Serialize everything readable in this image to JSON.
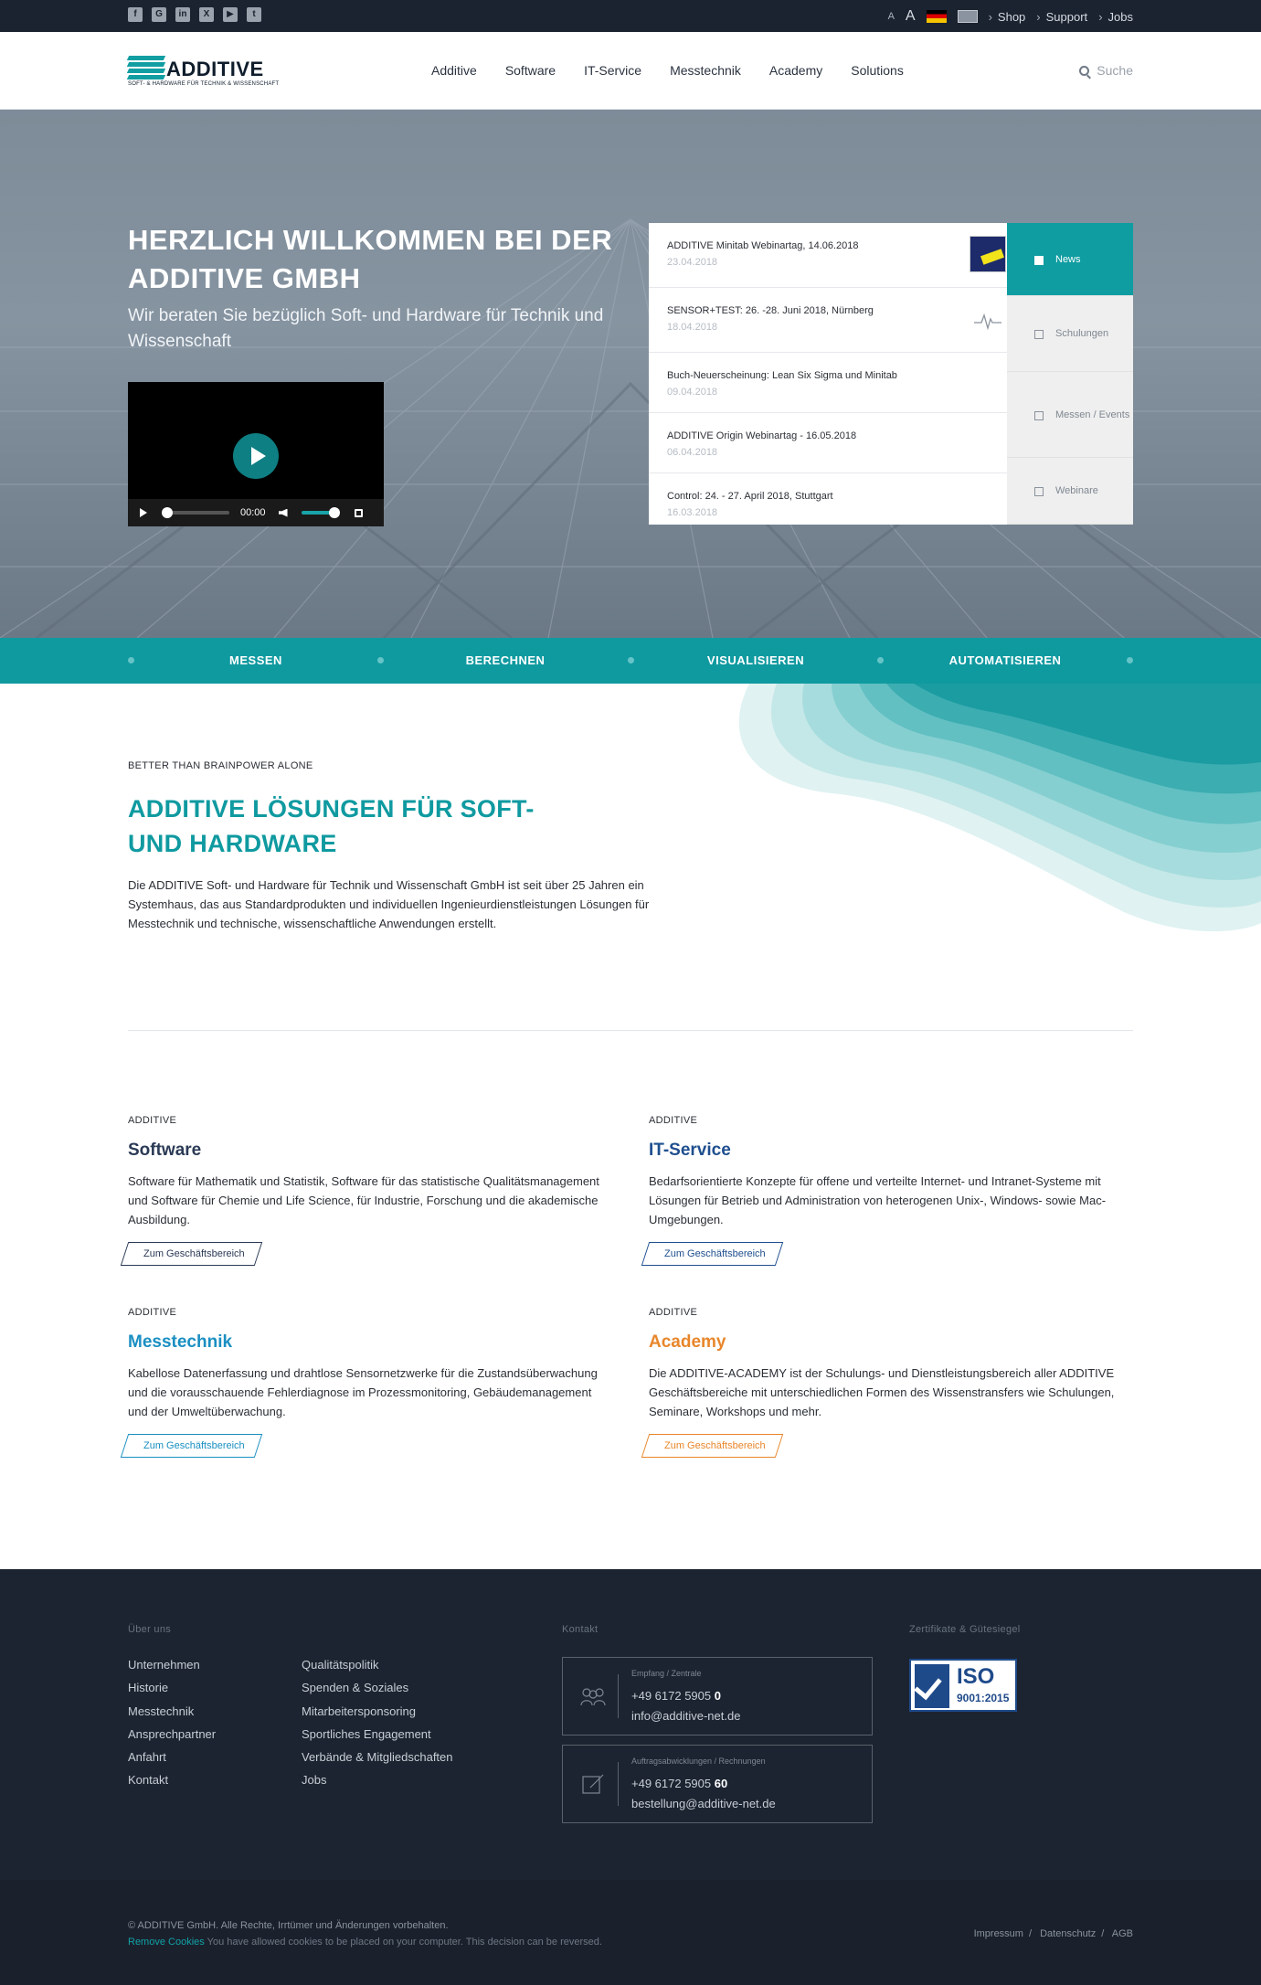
{
  "topbar": {
    "social_icons": [
      "facebook-icon",
      "google-plus-icon",
      "linkedin-icon",
      "xing-icon",
      "youtube-icon",
      "twitter-icon"
    ],
    "font_small": "A",
    "font_large": "A",
    "links": [
      "Shop",
      "Support",
      "Jobs"
    ]
  },
  "header": {
    "logo_text": "ADDITIVE",
    "logo_sub": "SOFT- & HARDWARE FÜR TECHNIK & WISSENSCHAFT",
    "nav": [
      "Additive",
      "Software",
      "IT-Service",
      "Messtechnik",
      "Academy",
      "Solutions"
    ],
    "search_placeholder": "Suche"
  },
  "hero": {
    "title": "HERZLICH WILLKOMMEN BEI DER ADDITIVE GMBH",
    "subtitle": "Wir beraten Sie bezüglich Soft- und Hardware für Technik und Wissenschaft",
    "video_time": "00:00",
    "news": [
      {
        "title": "ADDITIVE Minitab Webinartag, 14.06.2018",
        "date": "23.04.2018"
      },
      {
        "title": "SENSOR+TEST: 26. -28. Juni 2018, Nürnberg",
        "date": "18.04.2018"
      },
      {
        "title": "Buch-Neuerscheinung: Lean Six Sigma und Minitab",
        "date": "09.04.2018"
      },
      {
        "title": "ADDITIVE Origin Webinartag - 16.05.2018",
        "date": "06.04.2018"
      },
      {
        "title": "Control: 24. - 27. April 2018, Stuttgart",
        "date": "16.03.2018"
      }
    ],
    "tabs": [
      "News",
      "Schulungen",
      "Messen / Events",
      "Webinare"
    ]
  },
  "band": [
    "MESSEN",
    "BERECHNEN",
    "VISUALISIEREN",
    "AUTOMATISIEREN"
  ],
  "intro": {
    "eyebrow": "BETTER THAN BRAINPOWER ALONE",
    "title": "ADDITIVE LÖSUNGEN FÜR SOFT- UND HARDWARE",
    "text": "Die ADDITIVE Soft- und Hardware für Technik und Wissenschaft GmbH ist seit über 25 Jahren ein Systemhaus, das aus Standardprodukten und individuellen Ingenieurdienstleistungen Lösungen für Messtechnik und technische, wissenschaftliche Anwendungen erstellt."
  },
  "business": [
    {
      "eyebrow": "ADDITIVE",
      "title": "Software",
      "color": "#2b3a55",
      "text": "Software für Mathematik und Statistik, Software für das statistische Qualitätsmanagement und Software für Chemie und Life Science, für Industrie, Forschung und die akademische Ausbildung.",
      "button": "Zum Geschäftsbereich"
    },
    {
      "eyebrow": "ADDITIVE",
      "title": "IT-Service",
      "color": "#1f4f8f",
      "text": "Bedarfsorientierte Konzepte für offene und verteilte Internet- und Intranet-Systeme mit Lösungen für Betrieb und Administration von heterogenen Unix-, Windows- sowie Mac- Umgebungen.",
      "button": "Zum Geschäftsbereich"
    },
    {
      "eyebrow": "ADDITIVE",
      "title": "Messtechnik",
      "color": "#1a8fc2",
      "text": "Kabellose Datenerfassung und drahtlose Sensornetzwerke für die Zustandsüberwachung und die vorausschauende Fehlerdiagnose im Prozessmonitoring, Gebäudemanagement und der Umweltüberwachung.",
      "button": "Zum Geschäftsbereich"
    },
    {
      "eyebrow": "ADDITIVE",
      "title": "Academy",
      "color": "#e8862a",
      "text": "Die ADDITIVE-ACADEMY ist der Schulungs- und Dienstleistungsbereich aller ADDITIVE Geschäftsbereiche mit unterschiedlichen Formen des Wissenstransfers wie Schulungen, Seminare, Workshops und mehr.",
      "button": "Zum Geschäftsbereich"
    }
  ],
  "footer": {
    "about_heading": "Über uns",
    "col1": [
      "Unternehmen",
      "Historie",
      "Messtechnik",
      "Ansprechpartner",
      "Anfahrt",
      "Kontakt"
    ],
    "col2": [
      "Qualitätspolitik",
      "Spenden & Soziales",
      "Mitarbeitersponsoring",
      "Sportliches Engagement",
      "Verbände & Mitgliedschaften",
      "Jobs"
    ],
    "contact_heading": "Kontakt",
    "contacts": [
      {
        "label": "Empfang / Zentrale",
        "phone": "+49 6172 5905",
        "ext": "0",
        "email": "info@additive-net.de"
      },
      {
        "label": "Auftragsabwicklungen / Rechnungen",
        "phone": "+49 6172 5905",
        "ext": "60",
        "email": "bestellung@additive-net.de"
      }
    ],
    "cert_heading": "Zertifikate & Gütesiegel",
    "iso_title": "ISO",
    "iso_sub": "9001:2015"
  },
  "bottom": {
    "copyright": "© ADDITIVE GmbH. Alle Rechte, Irrtümer und Änderungen vorbehalten.",
    "remove_cookies": "Remove Cookies",
    "cookie_text": " You have allowed cookies to be placed on your computer. This decision can be reversed.",
    "legal": [
      "Impressum",
      "Datenschutz",
      "AGB"
    ]
  }
}
